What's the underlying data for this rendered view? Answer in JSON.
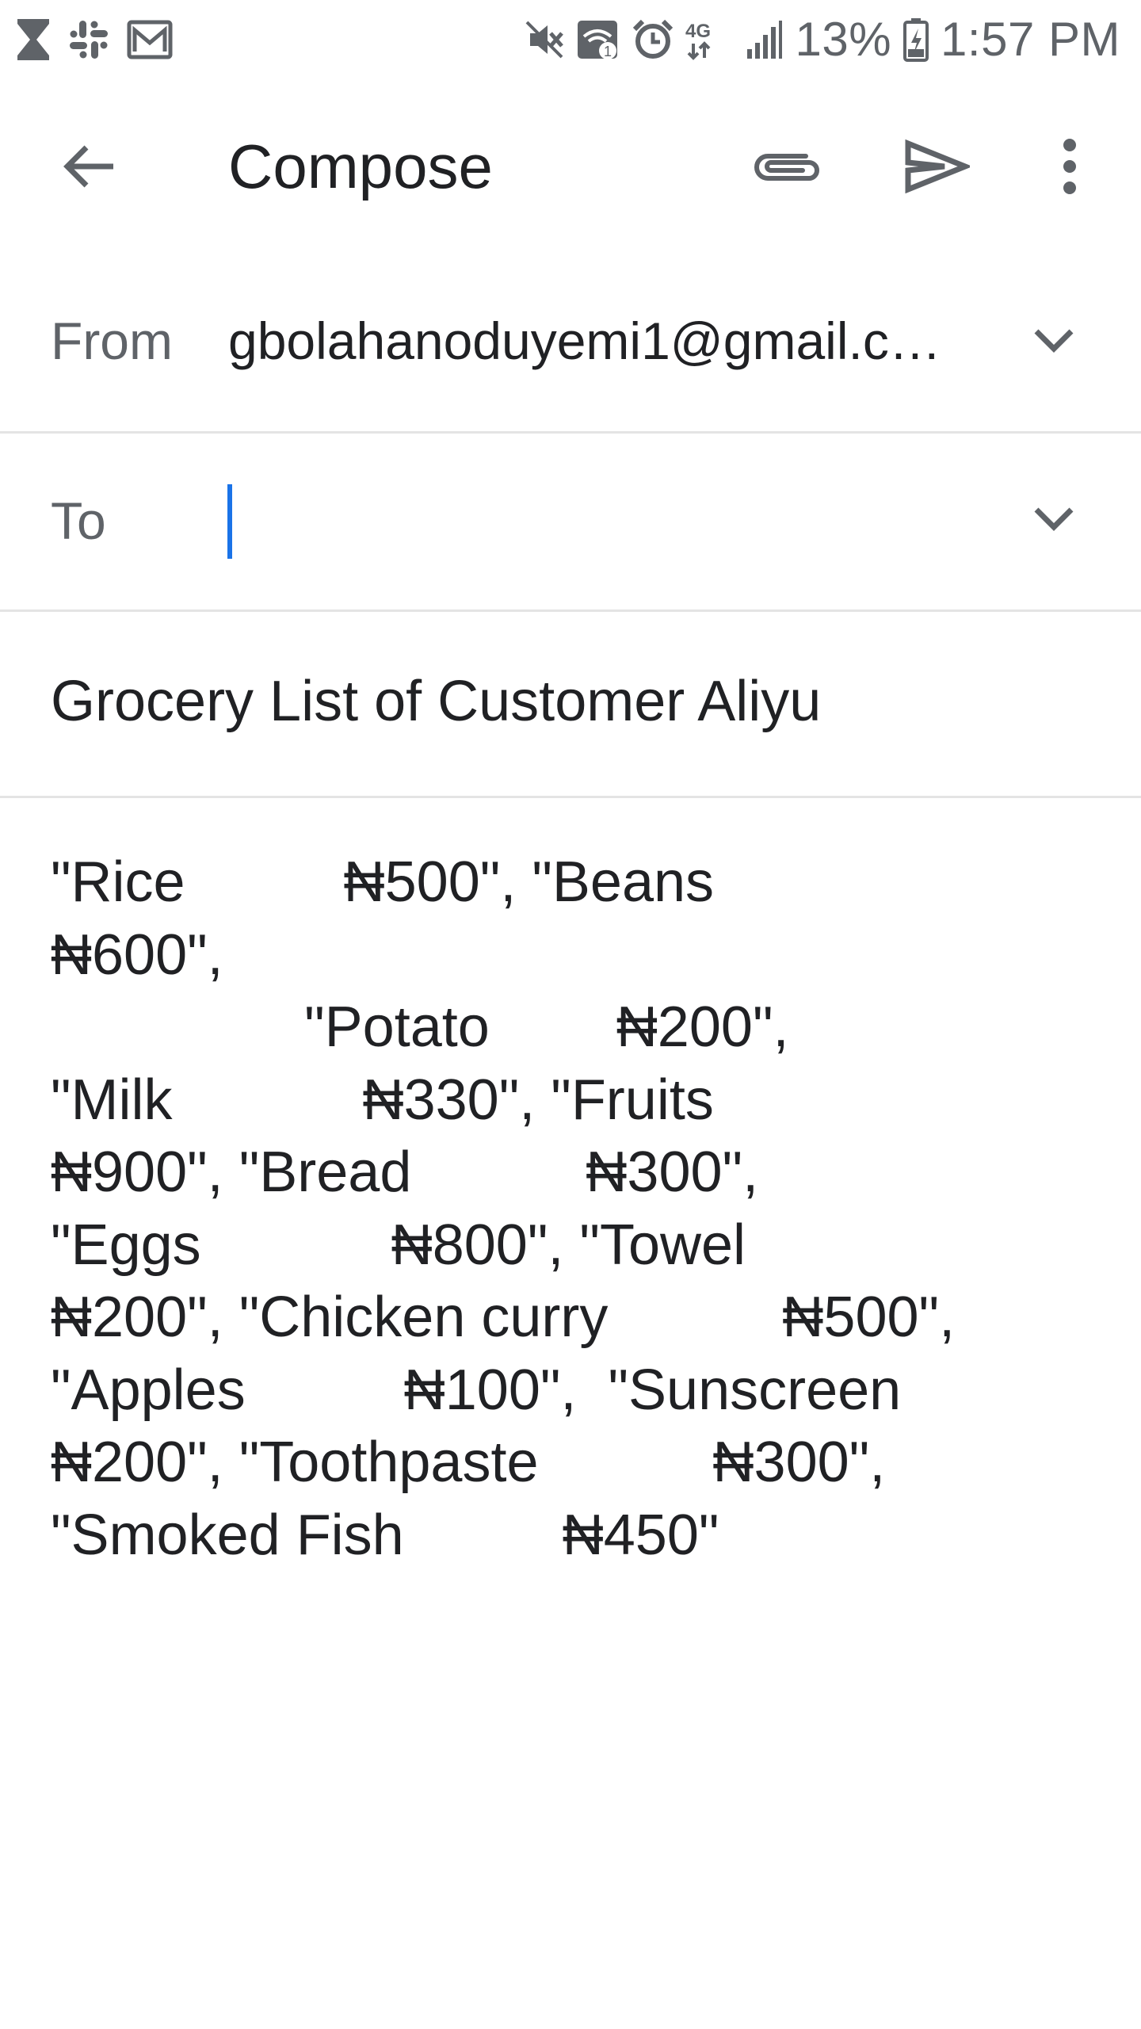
{
  "status_bar": {
    "left_icons": [
      "hourglass-icon",
      "slack-icon",
      "mail-icon"
    ],
    "right_icons": [
      "mute-icon",
      "wifi-calling-icon",
      "alarm-icon",
      "network-4g-icon",
      "signal-icon",
      "battery-charging-icon"
    ],
    "network": "4G",
    "battery": "13%",
    "time": "1:57 PM"
  },
  "app_bar": {
    "title": "Compose",
    "back_icon": "arrow-back-icon",
    "attach_icon": "paperclip-icon",
    "send_icon": "send-icon",
    "more_icon": "more-vert-icon"
  },
  "compose": {
    "from_label": "From",
    "from_value": "gbolahanoduyemi1@gmail.com",
    "to_label": "To",
    "to_value": "",
    "subject": "Grocery List of Customer Aliyu",
    "body": "\"Rice          ₦500\", \"Beans\n₦600\",\n                \"Potato        ₦200\",\n\"Milk            ₦330\", \"Fruits\n₦900\", \"Bread           ₦300\",\n\"Eggs            ₦800\", \"Towel\n₦200\", \"Chicken curry           ₦500\",\n\"Apples          ₦100\",  \"Sunscreen\n₦200\", \"Toothpaste           ₦300\",\n\"Smoked Fish          ₦450\""
  },
  "colors": {
    "accent": "#1a73e8",
    "text": "#202124",
    "label": "#5f6368",
    "divider": "#e4e4e4"
  }
}
